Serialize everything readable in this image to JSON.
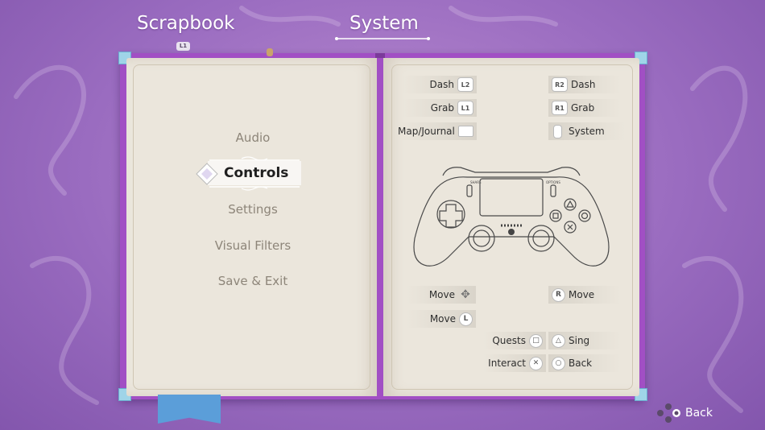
{
  "tabs": {
    "scrapbook": "Scrapbook",
    "scrapbook_button": "L1",
    "system": "System"
  },
  "menu": {
    "items": [
      "Audio",
      "Controls",
      "Settings",
      "Visual Filters",
      "Save & Exit"
    ],
    "selected": "Controls"
  },
  "bindings": {
    "left": [
      {
        "label": "Dash",
        "button": "L2"
      },
      {
        "label": "Grab",
        "button": "L1"
      },
      {
        "label": "Map/Journal",
        "button": "touchpad"
      }
    ],
    "right": [
      {
        "label": "Dash",
        "button": "R2"
      },
      {
        "label": "Grab",
        "button": "R1"
      },
      {
        "label": "System",
        "button": "options"
      }
    ],
    "sticks": [
      {
        "label": "Move",
        "button": "dpad"
      },
      {
        "label": "Move",
        "button": "L"
      },
      {
        "label": "Move",
        "button": "R"
      }
    ],
    "face": [
      {
        "label": "Quests",
        "button": "square"
      },
      {
        "label": "Sing",
        "button": "triangle"
      },
      {
        "label": "Interact",
        "button": "cross"
      },
      {
        "label": "Back",
        "button": "circle"
      }
    ]
  },
  "glyphs": {
    "L": "L",
    "R": "R",
    "square": "□",
    "triangle": "△",
    "cross": "✕",
    "circle": "○"
  },
  "controller_labels": {
    "share": "SHARE",
    "options": "OPTIONS"
  },
  "footer": {
    "back_label": "Back"
  },
  "colors": {
    "background": "#9a6cc0",
    "book_cover": "#a14fc4",
    "page": "#ebe6dc",
    "ribbon": "#5b9ed9"
  }
}
